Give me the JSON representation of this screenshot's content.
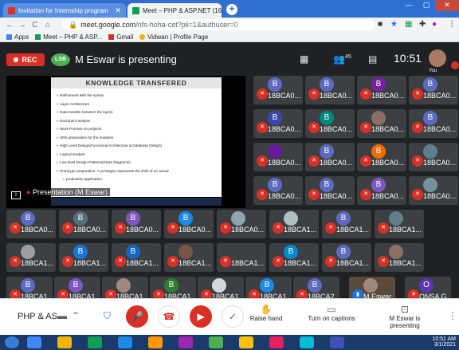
{
  "browser": {
    "tabs": [
      {
        "title": "Invitation for Internship program",
        "icon": "gmail-icon",
        "active": false
      },
      {
        "title": "Meet – PHP & ASP.NET (16C",
        "icon": "meet-icon",
        "active": true
      }
    ],
    "new_tab": "+",
    "url_main": "meet.google.com",
    "url_rest": "/nfs-hoha-cet?pli=1&authuser=0",
    "bookmarks": [
      {
        "label": "Apps",
        "icon": "apps-icon",
        "color": "#4285f4"
      },
      {
        "label": "Meet – PHP & ASP...",
        "icon": "meet-icon",
        "color": "#0f9d58"
      },
      {
        "label": "Gmail",
        "icon": "gmail-icon",
        "color": "#d93025"
      },
      {
        "label": "Vidwan | Profile Page",
        "icon": "vidwan-icon",
        "color": "#f4b400"
      }
    ]
  },
  "meet": {
    "rec_label": "REC",
    "presenter_logo": "LSB",
    "presenting_text": "M Eswar is presenting",
    "participant_count": "45",
    "time": "10:51",
    "you_label": "You",
    "presentation_label": "Presentation (M Eswar)",
    "slide": {
      "title": "KNOWLEDGE TRANSFERED",
      "items": [
        "Refinement with the syntax",
        "Layer Architecture",
        "Data transfer between the layers",
        "Document analyse",
        "Work Process on projects",
        "SRS preparation for the modules",
        "High Level Design(Functional Architecture & Database Design)",
        "Logical analyse",
        "Low level Design Patterns(Class Diagrams)",
        "Prototype preparation- A prototype represents the shell of an actual",
        "production application."
      ]
    },
    "grid": [
      [
        {
          "n": "18BCA0...",
          "a": "B",
          "c": "#5c6bc0"
        },
        {
          "n": "18BCA0...",
          "a": "B",
          "c": "#5c6bc0"
        },
        {
          "n": "18BCA0...",
          "a": "B",
          "c": "#7b1fa2"
        },
        {
          "n": "18BCA0...",
          "a": "B",
          "c": "#5c6bc0"
        }
      ],
      [
        {
          "n": "18BCA0...",
          "a": "B",
          "c": "#3949ab"
        },
        {
          "n": "18BCA0...",
          "a": "B",
          "c": "#00897b"
        },
        {
          "n": "18BCA0...",
          "a": "",
          "c": "#8d6e63"
        },
        {
          "n": "18BCA0...",
          "a": "B",
          "c": "#5c6bc0"
        }
      ],
      [
        {
          "n": "18BCA0...",
          "a": "",
          "c": "#6a1b9a"
        },
        {
          "n": "18BCA0...",
          "a": "B",
          "c": "#5c6bc0"
        },
        {
          "n": "18BCA0...",
          "a": "B",
          "c": "#ef6c00"
        },
        {
          "n": "18BCA0...",
          "a": "",
          "c": "#607d8b"
        }
      ],
      [
        {
          "n": "18BCA0...",
          "a": "B",
          "c": "#5c6bc0"
        },
        {
          "n": "18BCA0...",
          "a": "B",
          "c": "#5c6bc0"
        },
        {
          "n": "18BCA0...",
          "a": "B",
          "c": "#7e57c2"
        },
        {
          "n": "18BCA0...",
          "a": "",
          "c": "#78909c"
        }
      ],
      [
        {
          "n": "18BCA0...",
          "a": "B",
          "c": "#5c6bc0"
        },
        {
          "n": "18BCA0...",
          "a": "B",
          "c": "#546e7a"
        },
        {
          "n": "18BCA0...",
          "a": "B",
          "c": "#7e57c2"
        },
        {
          "n": "18BCA0...",
          "a": "B",
          "c": "#1e88e5"
        },
        {
          "n": "18BCA0...",
          "a": "",
          "c": "#90a4ae"
        },
        {
          "n": "18BCA1...",
          "a": "",
          "c": "#b0bec5"
        },
        {
          "n": "18BCA1...",
          "a": "B",
          "c": "#5c6bc0"
        },
        {
          "n": "18BCA1...",
          "a": "",
          "c": "#607d8b"
        }
      ],
      [
        {
          "n": "18BCA1...",
          "a": "",
          "c": "#9e9e9e"
        },
        {
          "n": "18BCA1...",
          "a": "B",
          "c": "#1976d2"
        },
        {
          "n": "18BCA1...",
          "a": "B",
          "c": "#1565c0"
        },
        {
          "n": "18BCA1...",
          "a": "",
          "c": "#795548"
        },
        {
          "n": "18BCA1...",
          "a": "",
          "c": ""
        },
        {
          "n": "18BCA1...",
          "a": "B",
          "c": "#0288d1"
        },
        {
          "n": "18BCA1...",
          "a": "B",
          "c": "#5c6bc0"
        },
        {
          "n": "18BCA1...",
          "a": "",
          "c": "#8d6e63"
        }
      ],
      [
        {
          "n": "18BCA1...",
          "a": "B",
          "c": "#5c6bc0"
        },
        {
          "n": "18BCA1...",
          "a": "B",
          "c": "#7e57c2"
        },
        {
          "n": "18BCA1...",
          "a": "",
          "c": "#a1887f"
        },
        {
          "n": "18BCA1...",
          "a": "B",
          "c": "#2e7d32"
        },
        {
          "n": "18BCA1...",
          "a": "",
          "c": "#cfd8dc"
        },
        {
          "n": "18BCA1...",
          "a": "B",
          "c": "#1e88e5"
        },
        {
          "n": "18BCA2...",
          "a": "B",
          "c": "#5c6bc0"
        },
        {
          "n": "M Eswar",
          "a": "",
          "c": "#a1887f"
        },
        {
          "n": "ONSA G...",
          "a": "O",
          "c": "#5e35b1"
        }
      ]
    ]
  },
  "controls": {
    "meeting_title": "PHP & AS...",
    "raise_hand": "Raise hand",
    "captions": "Turn on captions",
    "presenting": "M Eswar is presenting",
    "more": "⋮"
  },
  "taskbar": {
    "time": "10:51 AM",
    "date": "3/1/2021",
    "apps": [
      "#4285f4",
      "#f4b400",
      "#0f9d58",
      "#1e88e5",
      "#ff9800",
      "#9c27b0",
      "#4caf50",
      "#ffc107",
      "#e91e63",
      "#00bcd4",
      "#3f51b5"
    ]
  }
}
